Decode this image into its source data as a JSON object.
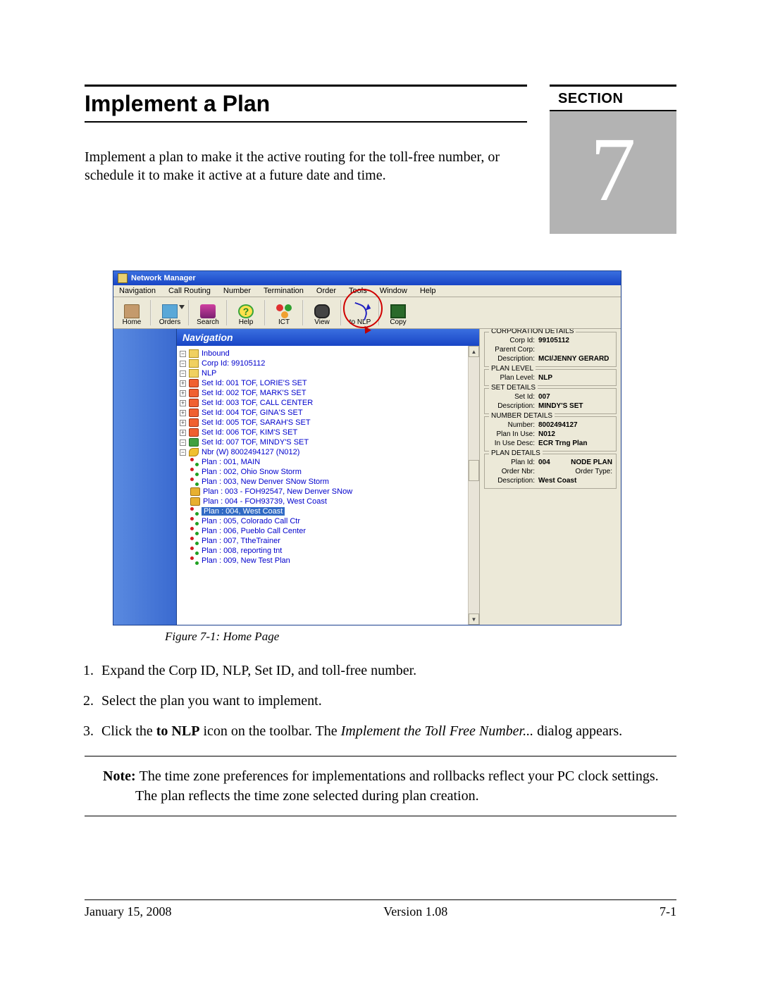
{
  "header": {
    "title": "Implement a Plan",
    "section_label": "SECTION",
    "section_number": "7",
    "intro": "Implement a plan to make it the active routing for the toll-free number, or schedule it to make it active at a future date and time."
  },
  "app": {
    "window_title": "Network Manager",
    "menu": [
      "Navigation",
      "Call Routing",
      "Number",
      "Termination",
      "Order",
      "Tools",
      "Window",
      "Help"
    ],
    "toolbar": {
      "home": "Home",
      "orders": "Orders",
      "search": "Search",
      "help": "Help",
      "ict": "ICT",
      "view": "View",
      "to_nlp": "to NLP",
      "copy": "Copy"
    },
    "nav_header": "Navigation",
    "tree": {
      "inbound": "Inbound",
      "corp": "Corp Id: 99105112",
      "nlp": "NLP",
      "sets": [
        "Set Id:  001 TOF, LORIE'S SET",
        "Set Id:  002 TOF, MARK'S SET",
        "Set Id:  003 TOF, CALL CENTER",
        "Set Id:  004 TOF, GINA'S SET",
        "Set Id:  005 TOF, SARAH'S SET",
        "Set Id:  006 TOF, KIM'S SET"
      ],
      "set_open": "Set Id:  007 TOF, MINDY'S SET",
      "nbr": "Nbr (W) 8002494127 (N012)",
      "plans": [
        "Plan : 001, MAIN",
        "Plan : 002, Ohio Snow Storm",
        "Plan : 003, New Denver SNow Storm",
        "Plan : 003 - FOH92547, New Denver SNow",
        "Plan : 004 - FOH93739, West Coast"
      ],
      "plan_selected": "Plan : 004, West Coast",
      "plans_after": [
        "Plan : 005, Colorado Call Ctr",
        "Plan : 006, Pueblo Call Center",
        "Plan : 007, TtheTrainer",
        "Plan : 008, reporting tnt",
        "Plan : 009, New Test Plan"
      ]
    },
    "details": {
      "corp": {
        "title": "CORPORATION DETAILS",
        "corp_id_l": "Corp Id:",
        "corp_id_v": "99105112",
        "parent_l": "Parent Corp:",
        "parent_v": "",
        "desc_l": "Description:",
        "desc_v": "MCI/JENNY GERARD"
      },
      "plan_level": {
        "title": "PLAN LEVEL",
        "lbl": "Plan Level:",
        "val": "NLP"
      },
      "set": {
        "title": "SET DETAILS",
        "id_l": "Set Id:",
        "id_v": "007",
        "desc_l": "Description:",
        "desc_v": "MINDY'S SET"
      },
      "number": {
        "title": "NUMBER DETAILS",
        "num_l": "Number:",
        "num_v": "8002494127",
        "piu_l": "Plan In Use:",
        "piu_v": "N012",
        "iud_l": "In Use Desc:",
        "iud_v": "ECR Trng Plan"
      },
      "plan": {
        "title": "PLAN DETAILS",
        "id_l": "Plan Id:",
        "id_v": "004",
        "node_plan": "NODE PLAN",
        "ord_l": "Order Nbr:",
        "ord_v": "",
        "ordtype_l": "Order Type:",
        "desc_l": "Description:",
        "desc_v": "West Coast"
      }
    }
  },
  "caption": "Figure 7-1:   Home Page",
  "steps": {
    "s1": "Expand the Corp ID, NLP, Set ID, and toll-free number.",
    "s2": "Select the plan you want to implement.",
    "s3a": "Click the ",
    "s3b": "to NLP",
    "s3c": " icon on the toolbar. The ",
    "s3d": "Implement the Toll Free Number...",
    "s3e": " dialog appears."
  },
  "note": {
    "label": "Note:",
    "text": "The time zone preferences for implementations and rollbacks reflect your PC clock settings. The plan reflects the time zone selected during plan creation."
  },
  "footer": {
    "date": "January 15, 2008",
    "version": "Version 1.08",
    "page": "7-1"
  }
}
